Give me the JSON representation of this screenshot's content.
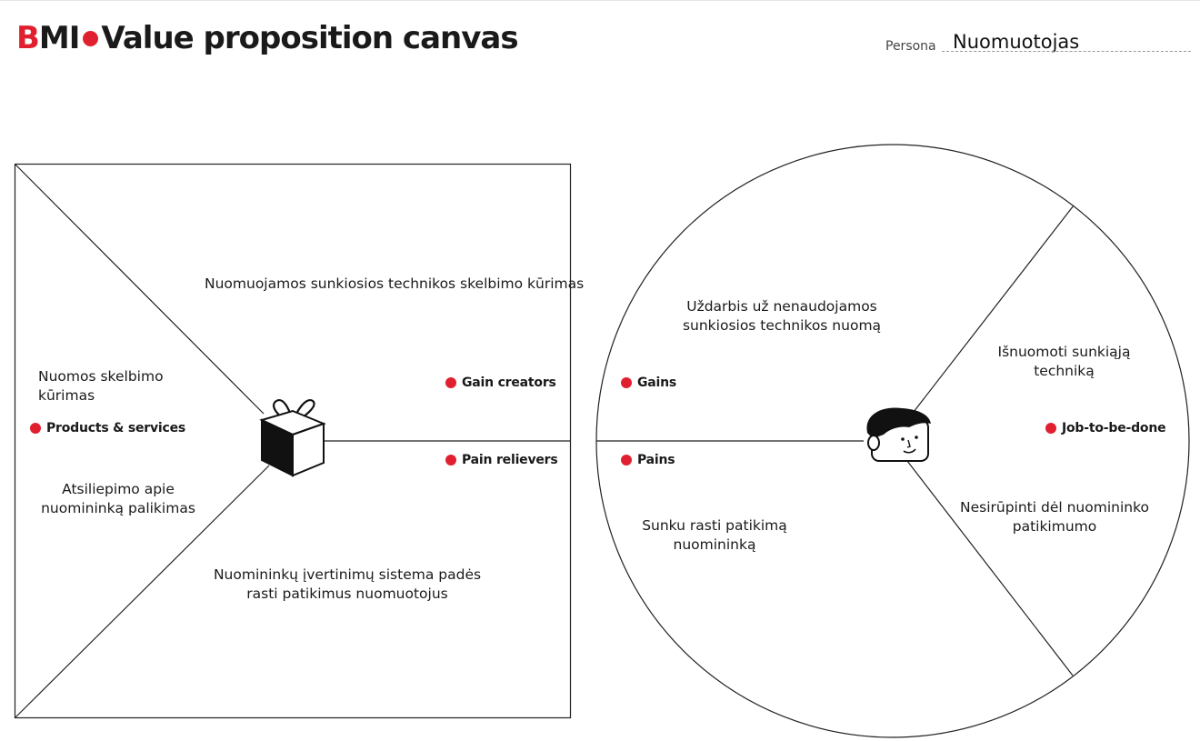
{
  "header": {
    "logo_b": "B",
    "logo_mi": "MI",
    "title": "Value proposition canvas",
    "brand_color": "#e0202f"
  },
  "persona": {
    "label": "Persona",
    "value": "Nuomuotojas"
  },
  "value_map": {
    "products_services": {
      "label": "Products & services",
      "items": [
        "Nuomos skelbimo kūrimas",
        "Atsiliepimo apie nuomininką palikimas"
      ]
    },
    "gain_creators": {
      "label": "Gain creators",
      "items": [
        "Nuomuojamos sunkiosios technikos skelbimo kūrimas"
      ]
    },
    "pain_relievers": {
      "label": "Pain relievers",
      "items": [
        "Nuomininkų įvertinimų sistema padės rasti patikimus nuomuotojus"
      ]
    },
    "icon": "gift-box-icon"
  },
  "customer_profile": {
    "gains": {
      "label": "Gains",
      "items": [
        "Uždarbis už nenaudojamos sunkiosios technikos nuomą"
      ]
    },
    "pains": {
      "label": "Pains",
      "items": [
        "Sunku rasti patikimą nuomininką"
      ]
    },
    "jobs": {
      "label": "Job-to-be-done",
      "items": [
        "Išnuomoti sunkiąją techniką",
        "Nesirūpinti dėl nuomininko patikimumo"
      ]
    },
    "icon": "customer-face-icon"
  },
  "colors": {
    "accent": "#e0202f",
    "line": "#222222"
  }
}
